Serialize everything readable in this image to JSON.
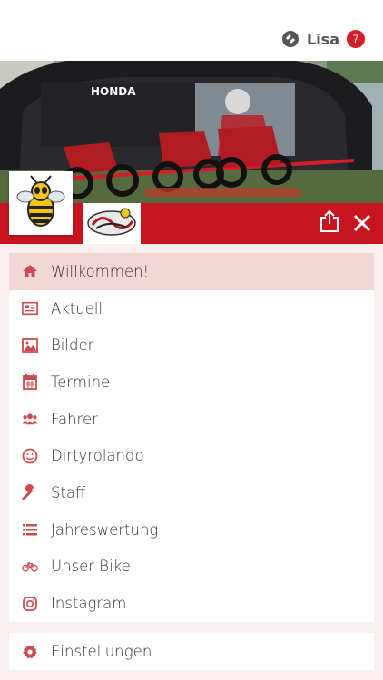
{
  "user": {
    "name": "Lisa",
    "badge_count": "7"
  },
  "colors": {
    "accent": "#c8141e",
    "icon": "#c84c50",
    "active_bg": "#f3d6d6"
  },
  "menu": [
    {
      "label": "Willkommen!",
      "icon": "home-icon",
      "active": true
    },
    {
      "label": "Aktuell",
      "icon": "newspaper-icon",
      "active": false
    },
    {
      "label": "Bilder",
      "icon": "image-icon",
      "active": false
    },
    {
      "label": "Termine",
      "icon": "calendar-icon",
      "active": false
    },
    {
      "label": "Fahrer",
      "icon": "users-icon",
      "active": false
    },
    {
      "label": "Dirtyrolando",
      "icon": "smiley-icon",
      "active": false
    },
    {
      "label": "Staff",
      "icon": "wrench-icon",
      "active": false
    },
    {
      "label": "Jahreswertung",
      "icon": "list-icon",
      "active": false
    },
    {
      "label": "Unser Bike",
      "icon": "bicycle-icon",
      "active": false
    },
    {
      "label": "Instagram",
      "icon": "instagram-icon",
      "active": false
    }
  ],
  "settings": {
    "label": "Einstellungen",
    "icon": "gear-icon"
  }
}
